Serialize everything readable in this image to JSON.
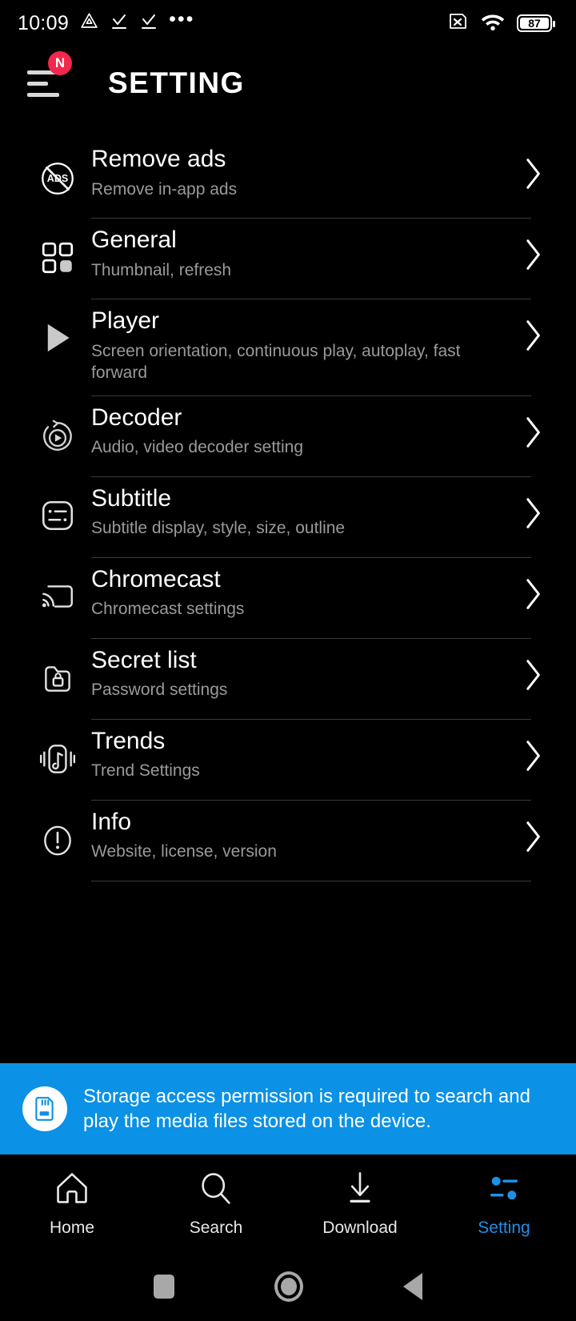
{
  "status_bar": {
    "time": "10:09",
    "left_icons": [
      "triangle-alert-icon",
      "check-download-icon",
      "check-download-icon",
      "more-dots-icon"
    ],
    "more_dots": "•••",
    "right_icons": [
      "sim-card-off-icon",
      "wifi-icon",
      "battery-icon"
    ],
    "battery_level": "87"
  },
  "app_bar": {
    "menu_icon": "hamburger-menu-icon",
    "badge": "N",
    "title": "SETTING"
  },
  "settings": {
    "items": [
      {
        "icon": "no-ads-icon",
        "title": "Remove ads",
        "subtitle": "Remove in-app ads"
      },
      {
        "icon": "grid-squares-icon",
        "title": "General",
        "subtitle": "Thumbnail, refresh"
      },
      {
        "icon": "play-icon",
        "title": "Player",
        "subtitle": "Screen orientation, continuous play, autoplay, fast forward"
      },
      {
        "icon": "decoder-icon",
        "title": "Decoder",
        "subtitle": "Audio, video decoder setting"
      },
      {
        "icon": "subtitle-icon",
        "title": "Subtitle",
        "subtitle": "Subtitle display, style, size, outline"
      },
      {
        "icon": "chromecast-icon",
        "title": "Chromecast",
        "subtitle": "Chromecast settings"
      },
      {
        "icon": "folder-lock-icon",
        "title": "Secret list",
        "subtitle": "Password settings"
      },
      {
        "icon": "music-trend-icon",
        "title": "Trends",
        "subtitle": "Trend Settings"
      },
      {
        "icon": "info-circle-icon",
        "title": "Info",
        "subtitle": "Website, license, version"
      }
    ]
  },
  "banner": {
    "icon": "sd-card-icon",
    "message": "Storage access permission is required to search and play the media files stored on the device.",
    "background_color": "#0b91e5"
  },
  "bottom_nav": {
    "active_color": "#1e90e8",
    "items": [
      {
        "icon": "home-icon",
        "label": "Home",
        "active": false
      },
      {
        "icon": "search-icon",
        "label": "Search",
        "active": false
      },
      {
        "icon": "download-icon",
        "label": "Download",
        "active": false
      },
      {
        "icon": "sliders-icon",
        "label": "Setting",
        "active": true
      }
    ]
  },
  "system_nav": {
    "items": [
      "recents-square-icon",
      "home-circle-icon",
      "back-triangle-icon"
    ]
  }
}
